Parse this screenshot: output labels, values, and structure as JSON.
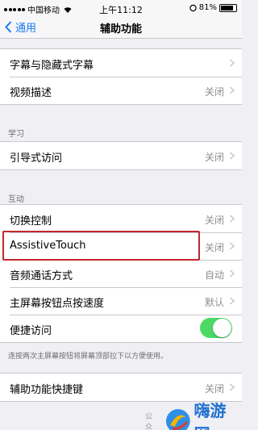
{
  "status_bar": {
    "carrier": "中国移动",
    "time": "上午11:12",
    "battery": "81%",
    "battery_level": 0.81
  },
  "nav": {
    "back_label": "通用",
    "title": "辅助功能"
  },
  "sections": {
    "top": {
      "rows": [
        {
          "label": "字幕与隐藏式字幕",
          "value": ""
        },
        {
          "label": "视频描述",
          "value": "关闭"
        }
      ]
    },
    "learning": {
      "header": "学习",
      "rows": [
        {
          "label": "引导式访问",
          "value": "关闭"
        }
      ]
    },
    "interaction": {
      "header": "互动",
      "rows": [
        {
          "label": "切换控制",
          "value": "关闭"
        },
        {
          "label": "AssistiveTouch",
          "value": "关闭"
        },
        {
          "label": "音频通话方式",
          "value": "自动"
        },
        {
          "label": "主屏幕按钮点按速度",
          "value": "默认"
        },
        {
          "label": "便捷访问",
          "toggle_on": true
        }
      ],
      "footer": "连按两次主屏幕按钮将屏幕顶部拉下以方便使用。"
    },
    "shortcut": {
      "rows": [
        {
          "label": "辅助功能快捷键",
          "value": "关闭"
        }
      ]
    }
  },
  "watermark": {
    "prefix": "公众",
    "brand": "嗨游网"
  },
  "colors": {
    "accent": "#1a7af8",
    "toggle_on": "#4cd964",
    "highlight": "#c0282d"
  },
  "icons": {
    "back": "chevron-left-icon",
    "row_disclosure": "chevron-right-icon"
  }
}
